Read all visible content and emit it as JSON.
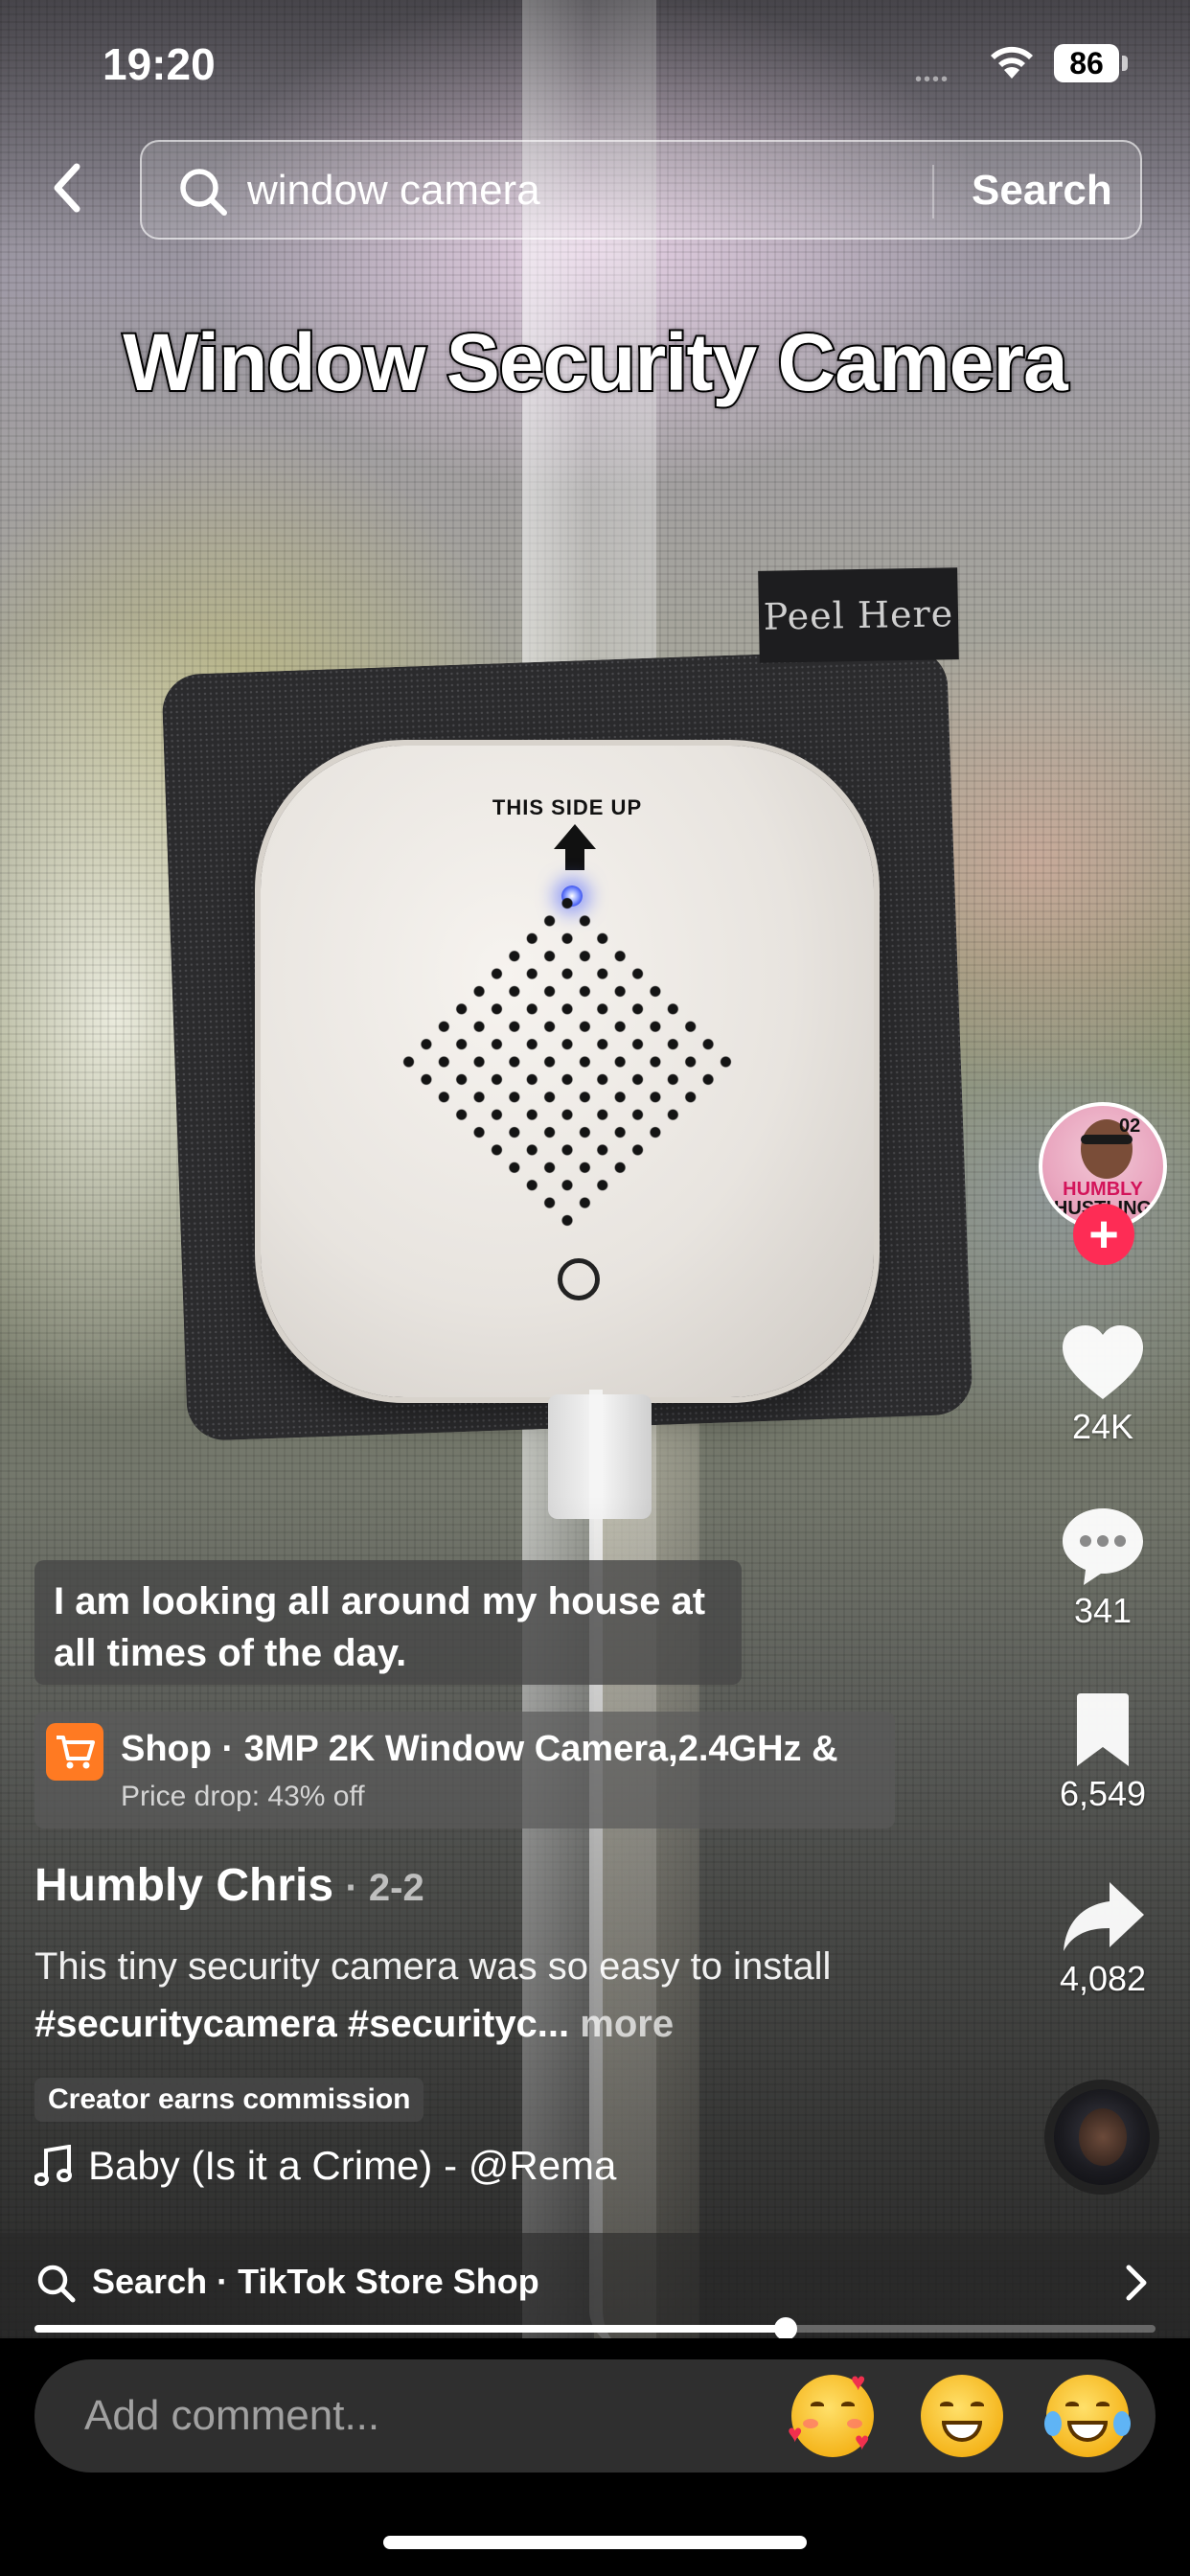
{
  "status_bar": {
    "time": "19:20",
    "battery": "86"
  },
  "search": {
    "query": "window camera",
    "button_label": "Search"
  },
  "video": {
    "title_overlay": "Window Security Camera",
    "pad_label": "Peel Here",
    "device_label": "THIS SIDE UP"
  },
  "rail": {
    "likes": "24K",
    "comments": "341",
    "saves": "6,549",
    "shares": "4,082",
    "avatar_text_line1": "HUMBLY",
    "avatar_text_line2": "HUSTLING",
    "avatar_badge": "02",
    "follow_symbol": "+"
  },
  "caption": {
    "bubble_text": "I am looking all around my house at all times of the day."
  },
  "shop": {
    "title": "Shop · 3MP 2K Window Camera,2.4GHz &",
    "subtitle": "Price drop: 43% off"
  },
  "post": {
    "author": "Humbly Chris",
    "date": "· 2-2",
    "description": "This tiny security camera was so easy to install ",
    "hashtags": "#securitycamera #securityc...",
    "more": " more",
    "commission_badge": "Creator earns commission",
    "music": "Baby (Is it a Crime) - @Rema"
  },
  "suggestion": {
    "text": "Search · TikTok Store Shop"
  },
  "playback": {
    "progress_fraction": 0.67
  },
  "comment_bar": {
    "placeholder": "Add comment..."
  },
  "icons": {
    "back": "chevron-left-icon",
    "search": "search-icon",
    "like": "heart-icon",
    "comment": "comment-bubble-icon",
    "save": "bookmark-icon",
    "share": "share-arrow-icon",
    "music": "music-note-icon",
    "cart": "shopping-cart-icon",
    "chevron_right": "chevron-right-icon"
  },
  "colors": {
    "follow_red": "#fe2c55",
    "cart_orange": "#ff7a22"
  }
}
